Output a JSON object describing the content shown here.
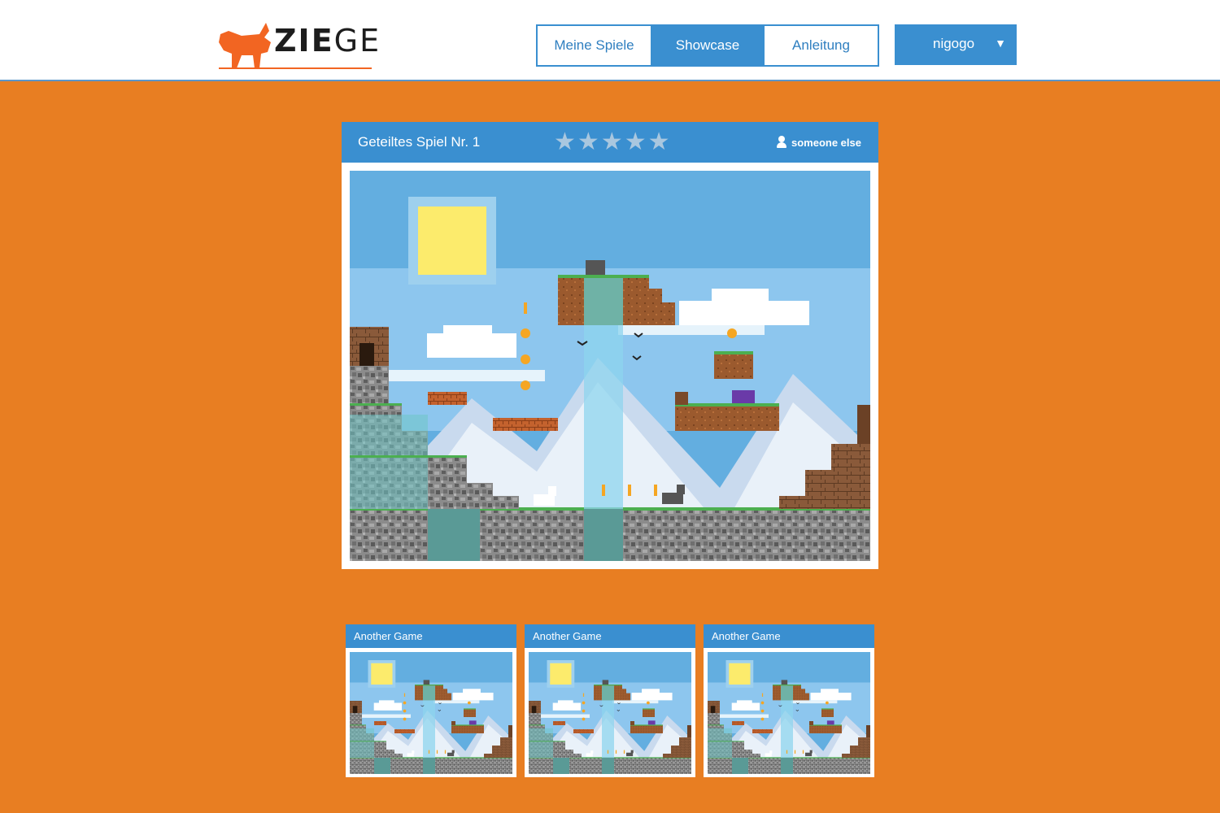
{
  "app": {
    "logo_text_bold": "ZIE",
    "logo_text_light": "GE",
    "brand_color": "#F26522",
    "accent_color": "#3A8FD0",
    "background_color": "#E87E22"
  },
  "nav": {
    "tabs": [
      {
        "label": "Meine Spiele",
        "active": false
      },
      {
        "label": "Showcase",
        "active": true
      },
      {
        "label": "Anleitung",
        "active": false
      }
    ]
  },
  "user_menu": {
    "name": "nigogo",
    "caret_icon": "triangle-down-icon"
  },
  "featured": {
    "title": "Geteiltes Spiel Nr. 1",
    "rating": {
      "value": 0,
      "max": 5,
      "icon": "star-icon"
    },
    "owner": "someone else",
    "owner_icon": "user-icon"
  },
  "more_games": [
    {
      "title": "Another Game"
    },
    {
      "title": "Another Game"
    },
    {
      "title": "Another Game"
    }
  ]
}
